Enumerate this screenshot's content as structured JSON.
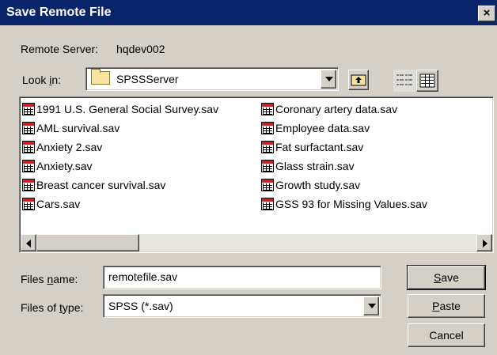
{
  "window": {
    "title": "Save Remote File",
    "close_label": "×"
  },
  "server": {
    "label": "Remote Server:",
    "name": "hqdev002"
  },
  "look_in": {
    "label_pre": "Look ",
    "label_accel": "i",
    "label_post": "n:",
    "value": "SPSSServer",
    "icon": "folder-icon"
  },
  "toolbar": {
    "up_icon": "up-one-level-icon",
    "list_icon": "list-view-icon",
    "details_icon": "details-view-icon"
  },
  "files": [
    {
      "name": "1991 U.S. General Social Survey.sav"
    },
    {
      "name": "AML survival.sav"
    },
    {
      "name": "Anxiety 2.sav"
    },
    {
      "name": "Anxiety.sav"
    },
    {
      "name": "Breast cancer survival.sav"
    },
    {
      "name": "Cars.sav"
    },
    {
      "name": "Coronary artery data.sav"
    },
    {
      "name": "Employee data.sav"
    },
    {
      "name": "Fat surfactant.sav"
    },
    {
      "name": "Glass strain.sav"
    },
    {
      "name": "Growth study.sav"
    },
    {
      "name": "GSS 93 for Missing Values.sav"
    }
  ],
  "file_name": {
    "label_pre": "Files ",
    "label_accel": "n",
    "label_post": "ame:",
    "value": "remotefile.sav"
  },
  "file_type": {
    "label_pre": "Files of ",
    "label_accel": "t",
    "label_post": "ype:",
    "value": "SPSS (*.sav)"
  },
  "buttons": {
    "save_accel": "S",
    "save_rest": "ave",
    "paste_accel": "P",
    "paste_rest": "aste",
    "cancel": "Cancel"
  }
}
